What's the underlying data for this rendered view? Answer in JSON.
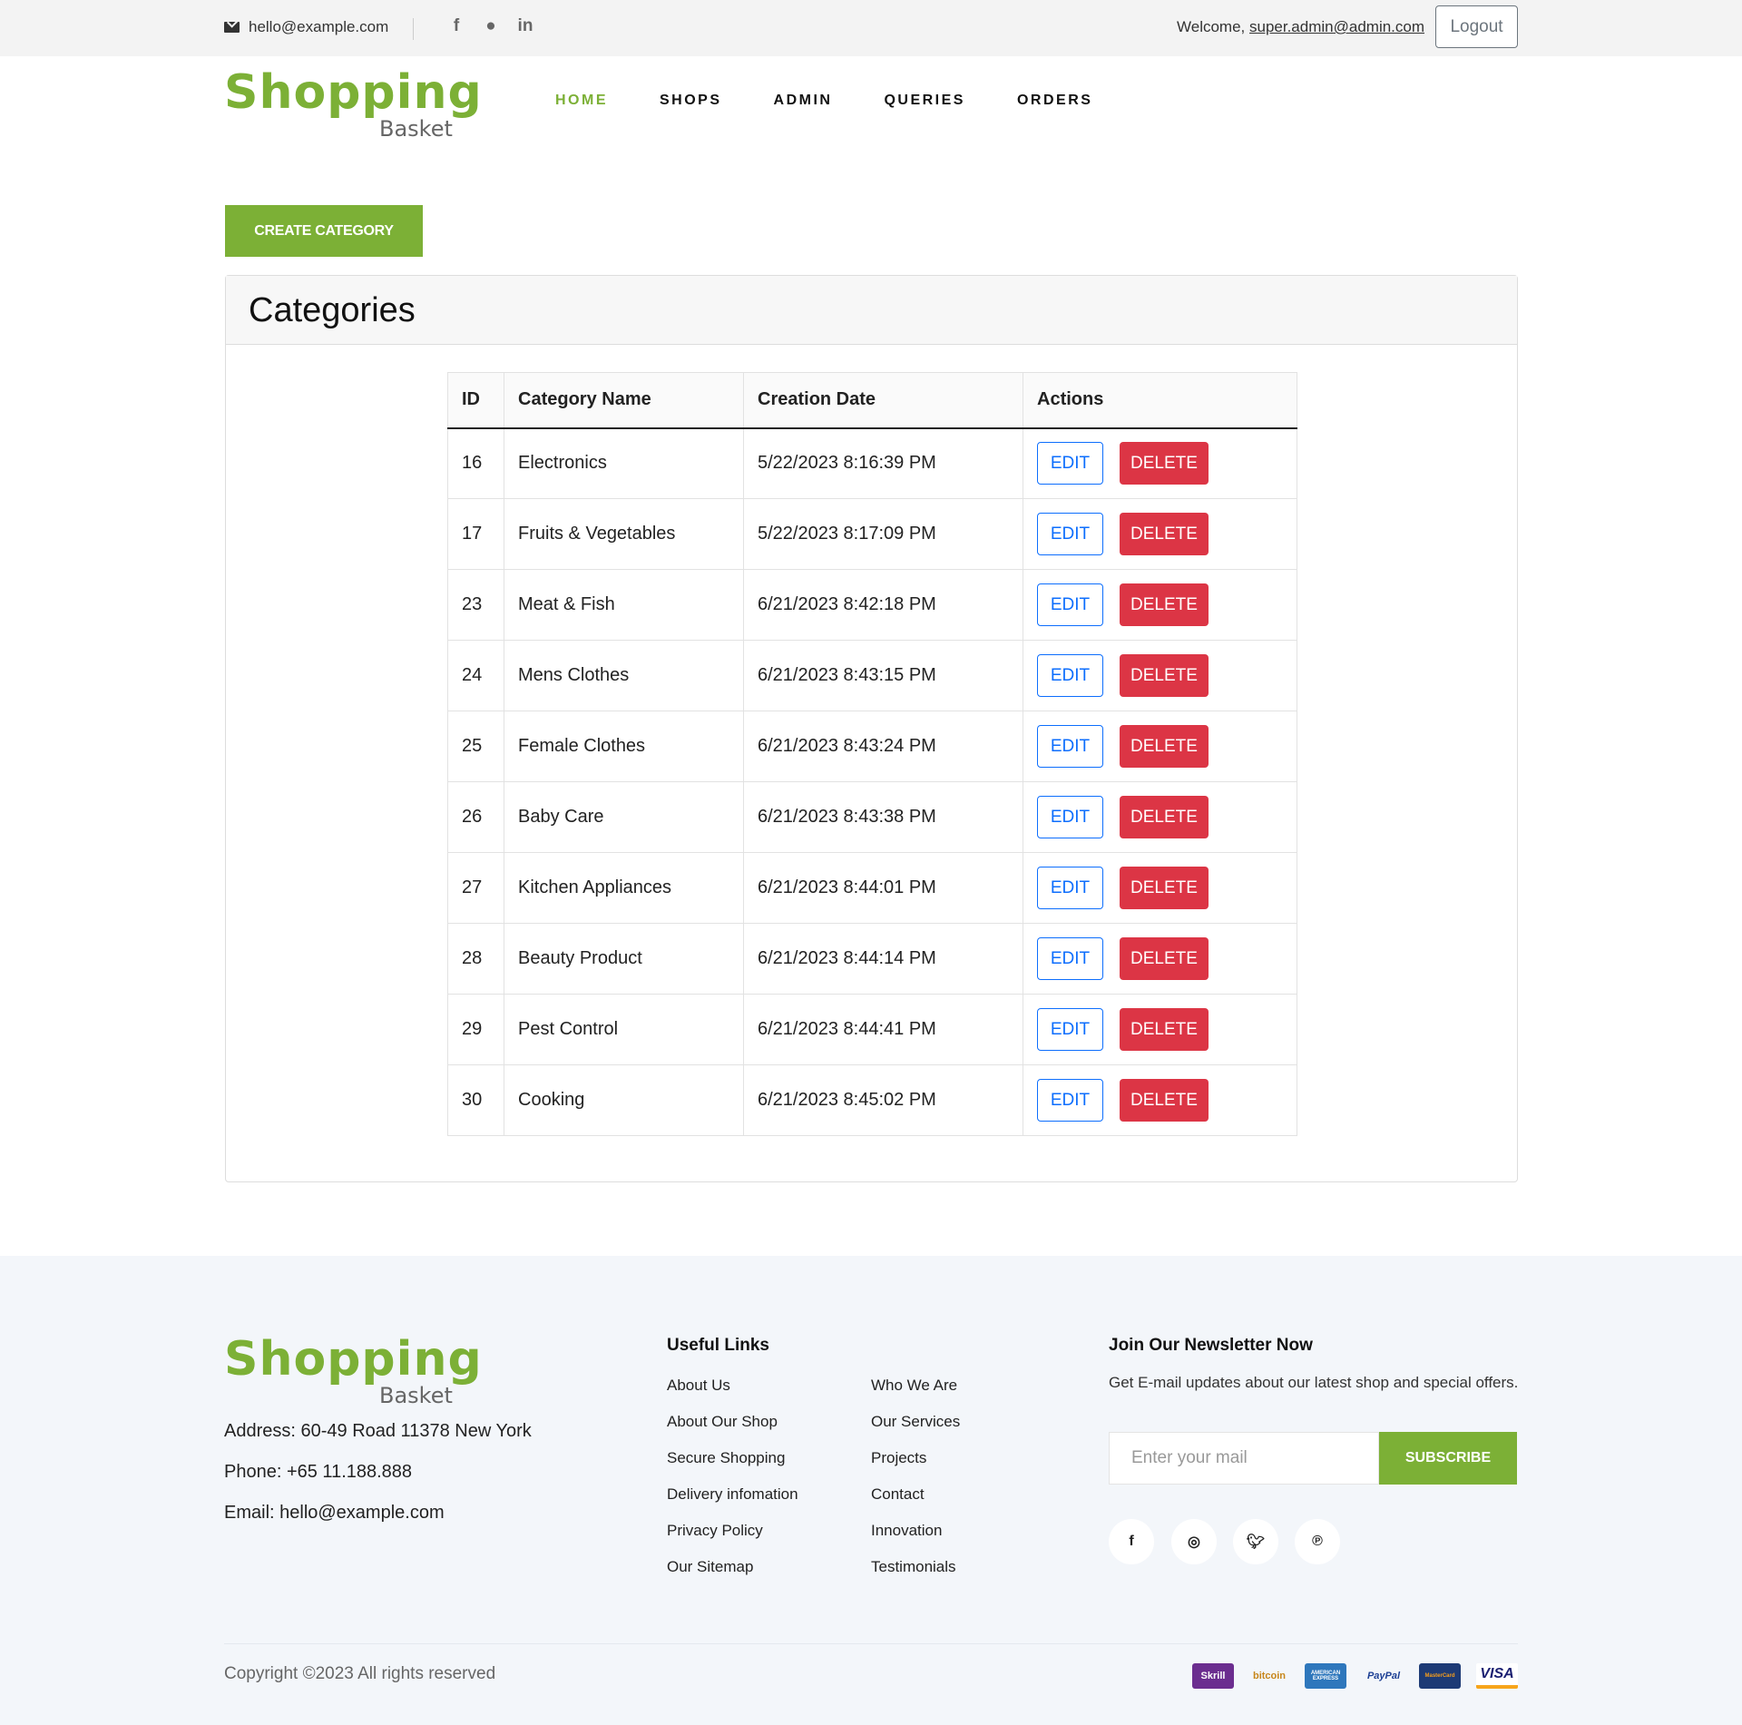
{
  "topbar": {
    "email": "hello@example.com",
    "social_icons": [
      "facebook-icon",
      "github-icon",
      "linkedin-icon"
    ],
    "welcome_prefix": "Welcome,",
    "user_email": "super.admin@admin.com",
    "logout_label": "Logout"
  },
  "logo": {
    "line1": "Shopping",
    "line2": "Basket"
  },
  "nav": [
    {
      "label": "HOME",
      "active": true
    },
    {
      "label": "SHOPS",
      "active": false
    },
    {
      "label": "ADMIN",
      "active": false
    },
    {
      "label": "QUERIES",
      "active": false
    },
    {
      "label": "ORDERS",
      "active": false
    }
  ],
  "create_button": "CREATE CATEGORY",
  "card_title": "Categories",
  "table": {
    "columns": [
      "ID",
      "Category Name",
      "Creation Date",
      "Actions"
    ],
    "edit_label": "EDIT",
    "delete_label": "DELETE",
    "rows": [
      {
        "id": "16",
        "name": "Electronics",
        "date": "5/22/2023 8:16:39 PM"
      },
      {
        "id": "17",
        "name": "Fruits & Vegetables",
        "date": "5/22/2023 8:17:09 PM"
      },
      {
        "id": "23",
        "name": "Meat & Fish",
        "date": "6/21/2023 8:42:18 PM"
      },
      {
        "id": "24",
        "name": "Mens Clothes",
        "date": "6/21/2023 8:43:15 PM"
      },
      {
        "id": "25",
        "name": "Female Clothes",
        "date": "6/21/2023 8:43:24 PM"
      },
      {
        "id": "26",
        "name": "Baby Care",
        "date": "6/21/2023 8:43:38 PM"
      },
      {
        "id": "27",
        "name": "Kitchen Appliances",
        "date": "6/21/2023 8:44:01 PM"
      },
      {
        "id": "28",
        "name": "Beauty Product",
        "date": "6/21/2023 8:44:14 PM"
      },
      {
        "id": "29",
        "name": "Pest Control",
        "date": "6/21/2023 8:44:41 PM"
      },
      {
        "id": "30",
        "name": "Cooking",
        "date": "6/21/2023 8:45:02 PM"
      }
    ]
  },
  "footer": {
    "address": "Address: 60-49 Road 11378 New York",
    "phone": "Phone: +65 11.188.888",
    "email": "Email: hello@example.com",
    "useful_links_title": "Useful Links",
    "links_col1": [
      "About Us",
      "About Our Shop",
      "Secure Shopping",
      "Delivery infomation",
      "Privacy Policy",
      "Our Sitemap"
    ],
    "links_col2": [
      "Who We Are",
      "Our Services",
      "Projects",
      "Contact",
      "Innovation",
      "Testimonials"
    ],
    "newsletter_title": "Join Our Newsletter Now",
    "newsletter_text": "Get E-mail updates about our latest shop and special offers.",
    "newsletter_placeholder": "Enter your mail",
    "subscribe_label": "SUBSCRIBE",
    "social_icons": [
      "facebook-icon",
      "instagram-icon",
      "twitter-icon",
      "pinterest-icon"
    ],
    "copyright": "Copyright ©2023 All rights reserved",
    "payment_methods": [
      "Skrill",
      "bitcoin",
      "AMERICAN EXPRESS",
      "PayPal",
      "MasterCard",
      "VISA"
    ]
  },
  "colors": {
    "brand": "#7cb036",
    "danger": "#dc3545",
    "primary": "#0d6efd"
  }
}
